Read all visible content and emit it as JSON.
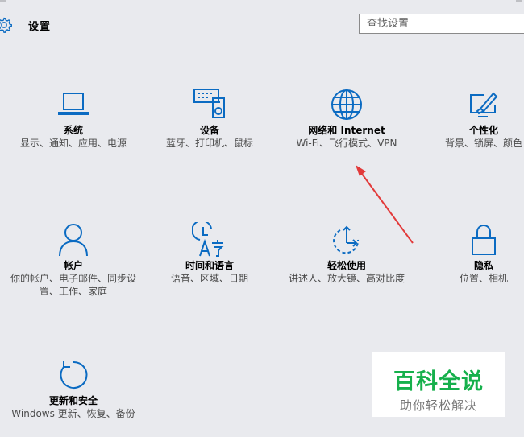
{
  "header": {
    "title": "设置"
  },
  "search": {
    "placeholder": "查找设置"
  },
  "tiles": [
    {
      "name": "系统",
      "desc": "显示、通知、应用、电源"
    },
    {
      "name": "设备",
      "desc": "蓝牙、打印机、鼠标"
    },
    {
      "name": "网络和 Internet",
      "desc": "Wi-Fi、飞行模式、VPN"
    },
    {
      "name": "个性化",
      "desc": "背景、锁屏、颜色"
    },
    {
      "name": "帐户",
      "desc": "你的帐户、电子邮件、同步设置、工作、家庭"
    },
    {
      "name": "时间和语言",
      "desc": "语音、区域、日期"
    },
    {
      "name": "轻松使用",
      "desc": "讲述人、放大镜、高对比度"
    },
    {
      "name": "隐私",
      "desc": "位置、相机"
    },
    {
      "name": "更新和安全",
      "desc": "Windows 更新、恢复、备份"
    }
  ],
  "watermark": {
    "title": "百科全说",
    "subtitle": "助你轻松解决"
  },
  "colors": {
    "accent": "#0b6bc2",
    "background": "#e9eaee",
    "annotation_arrow": "#e23a3a",
    "watermark_green": "#16b04c"
  }
}
